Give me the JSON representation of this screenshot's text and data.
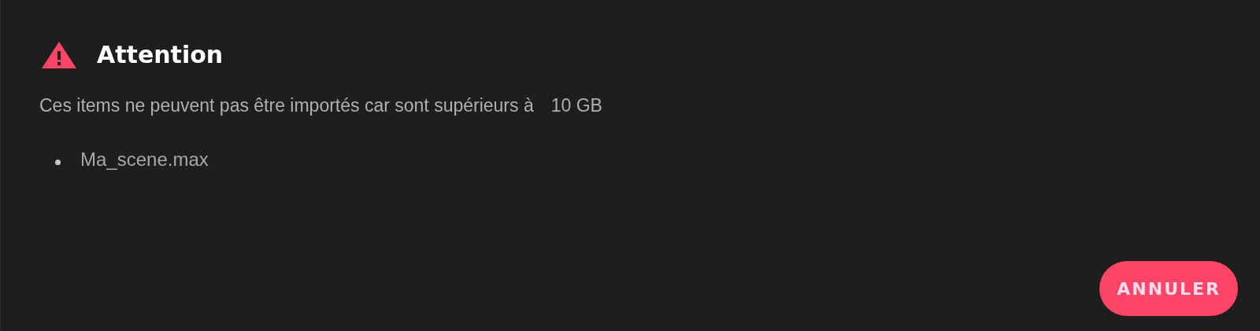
{
  "dialog": {
    "title": "Attention",
    "message": "Ces items ne peuvent pas être importés car sont supérieurs à",
    "limit": "10 GB",
    "items": [
      "Ma_scene.max"
    ],
    "buttons": [
      {
        "label": "ANNULER",
        "kind": "primary"
      }
    ]
  }
}
